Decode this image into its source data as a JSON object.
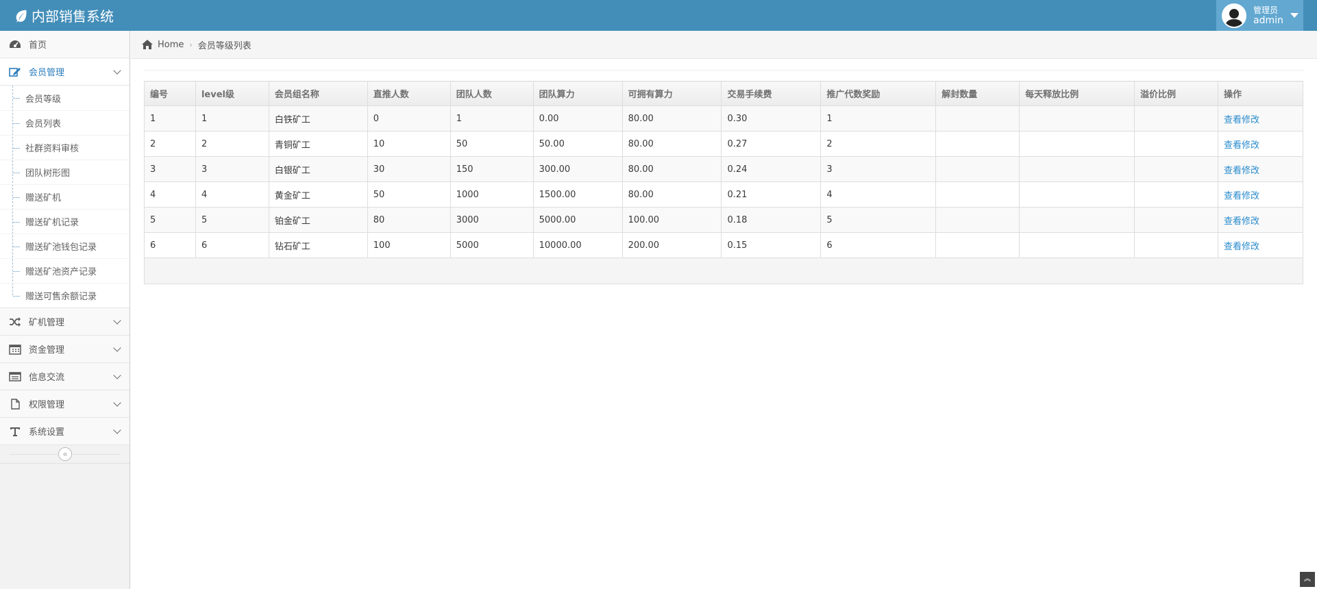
{
  "app": {
    "title": "内部销售系统"
  },
  "user": {
    "role": "管理员",
    "name": "admin"
  },
  "sidebar": {
    "items": [
      {
        "label": "首页",
        "icon": "dashboard-icon"
      },
      {
        "label": "会员管理",
        "icon": "edit-icon",
        "expanded": true,
        "children": [
          "会员等级",
          "会员列表",
          "社群资料审核",
          "团队树形图",
          "赠送矿机",
          "赠送矿机记录",
          "赠送矿池钱包记录",
          "赠送矿池资产记录",
          "赠送可售余额记录"
        ]
      },
      {
        "label": "矿机管理",
        "icon": "random-icon"
      },
      {
        "label": "资金管理",
        "icon": "calendar-icon"
      },
      {
        "label": "信息交流",
        "icon": "list-icon"
      },
      {
        "label": "权限管理",
        "icon": "file-icon"
      },
      {
        "label": "系统设置",
        "icon": "text-icon"
      }
    ]
  },
  "breadcrumb": {
    "home": "Home",
    "current": "会员等级列表"
  },
  "table": {
    "columns": [
      "编号",
      "level级",
      "会员组名称",
      "直推人数",
      "团队人数",
      "团队算力",
      "可拥有算力",
      "交易手续费",
      "推广代数奖励",
      "解封数量",
      "每天释放比例",
      "溢价比例",
      "操作"
    ],
    "rows": [
      [
        "1",
        "1",
        "白铁矿工",
        "0",
        "1",
        "0.00",
        "80.00",
        "0.30",
        "1",
        "",
        "",
        "",
        "查看修改"
      ],
      [
        "2",
        "2",
        "青铜矿工",
        "10",
        "50",
        "50.00",
        "80.00",
        "0.27",
        "2",
        "",
        "",
        "",
        "查看修改"
      ],
      [
        "3",
        "3",
        "白银矿工",
        "30",
        "150",
        "300.00",
        "80.00",
        "0.24",
        "3",
        "",
        "",
        "",
        "查看修改"
      ],
      [
        "4",
        "4",
        "黄金矿工",
        "50",
        "1000",
        "1500.00",
        "80.00",
        "0.21",
        "4",
        "",
        "",
        "",
        "查看修改"
      ],
      [
        "5",
        "5",
        "铂金矿工",
        "80",
        "3000",
        "5000.00",
        "100.00",
        "0.18",
        "5",
        "",
        "",
        "",
        "查看修改"
      ],
      [
        "6",
        "6",
        "钻石矿工",
        "100",
        "5000",
        "10000.00",
        "200.00",
        "0.15",
        "6",
        "",
        "",
        "",
        "查看修改"
      ]
    ]
  },
  "colors": {
    "navbar": "#438eb9",
    "user_box": "#62a8d1",
    "link": "#2a8bcc",
    "active_nav": "#2b7dbc"
  }
}
